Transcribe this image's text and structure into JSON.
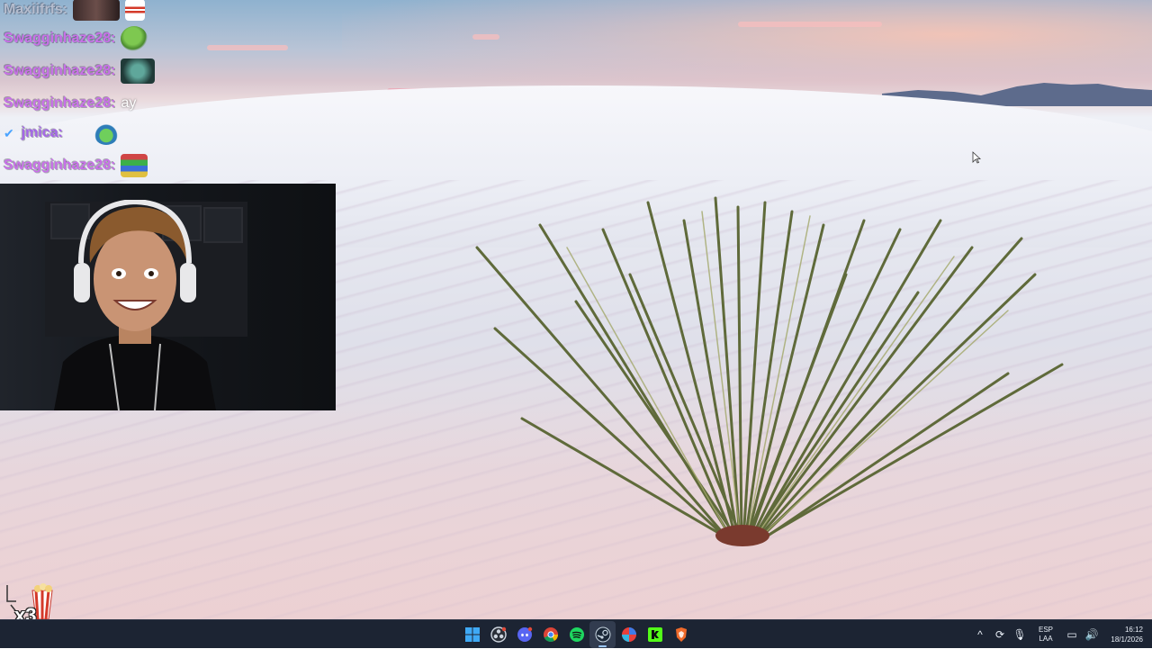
{
  "chat": {
    "messages": [
      {
        "user": "Maxiifrfs",
        "sep": ":",
        "text": "",
        "emote": "photo-emote"
      },
      {
        "user": "Swagginhaze28",
        "sep": ":",
        "text": "",
        "emote": "pepe-emote"
      },
      {
        "user": "Swagginhaze28",
        "sep": ":",
        "text": "",
        "emote": "teal-creature-emote"
      },
      {
        "user": "Swagginhaze28",
        "sep": ":",
        "text": "ay",
        "emote": ""
      },
      {
        "user": "jmica",
        "sep": ":",
        "text": "",
        "emote": "pepe-hat-emote"
      },
      {
        "user": "Swagginhaze28",
        "sep": ":",
        "text": "",
        "emote": "books-emote"
      }
    ]
  },
  "overlay": {
    "combo": "x3",
    "combo_emote": "popcorn-emote"
  },
  "taskbar": {
    "apps": [
      {
        "name": "windows-start-icon",
        "active": false
      },
      {
        "name": "obs-icon",
        "active": false
      },
      {
        "name": "discord-icon",
        "active": false
      },
      {
        "name": "chrome-icon",
        "active": false
      },
      {
        "name": "spotify-icon",
        "active": false
      },
      {
        "name": "steam-icon",
        "active": true
      },
      {
        "name": "browser-icon",
        "active": false
      },
      {
        "name": "kick-icon",
        "active": false
      },
      {
        "name": "brave-icon",
        "active": false
      }
    ],
    "tray": {
      "lang_top": "ESP",
      "lang_bottom": "LAA",
      "time": "16:12",
      "date": "18/1/2026"
    }
  },
  "colors": {
    "taskbar_bg": "#1c2433",
    "username_purple": "#c870e8",
    "username_gray": "#b4bccd"
  }
}
